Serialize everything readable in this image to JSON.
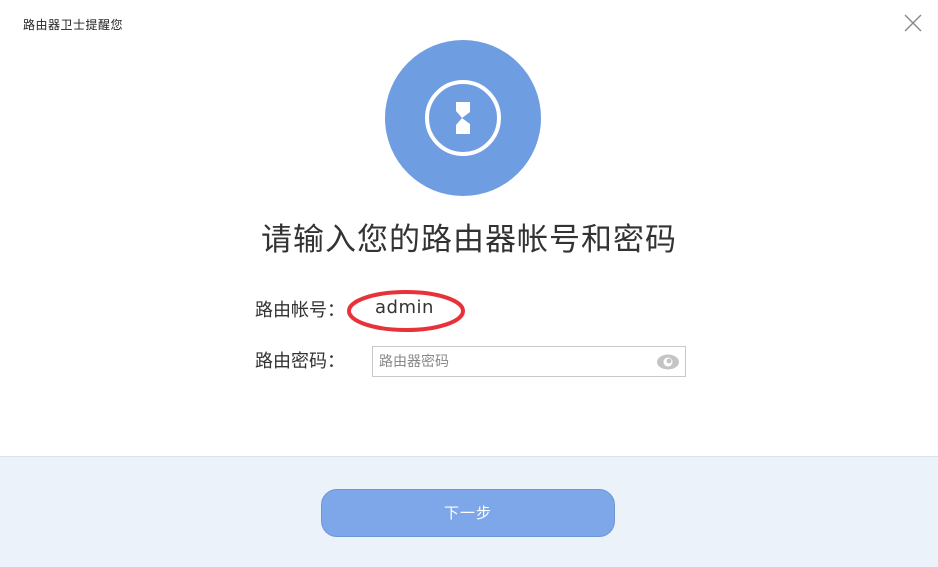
{
  "window": {
    "title": "路由器卫士提醒您",
    "close_icon": "close-icon"
  },
  "logo": {
    "icon": "router-key-icon",
    "color": "#6f9de1"
  },
  "headline": "请输入您的路由器帐号和密码",
  "form": {
    "account_label": "路由帐号：",
    "account_value": "admin",
    "password_label": "路由密码：",
    "password_placeholder": "路由器密码",
    "password_value": "",
    "eye_icon": "show-password-eye-icon"
  },
  "footer": {
    "next_button": "下一步",
    "accent_color": "#7ea7ea"
  }
}
